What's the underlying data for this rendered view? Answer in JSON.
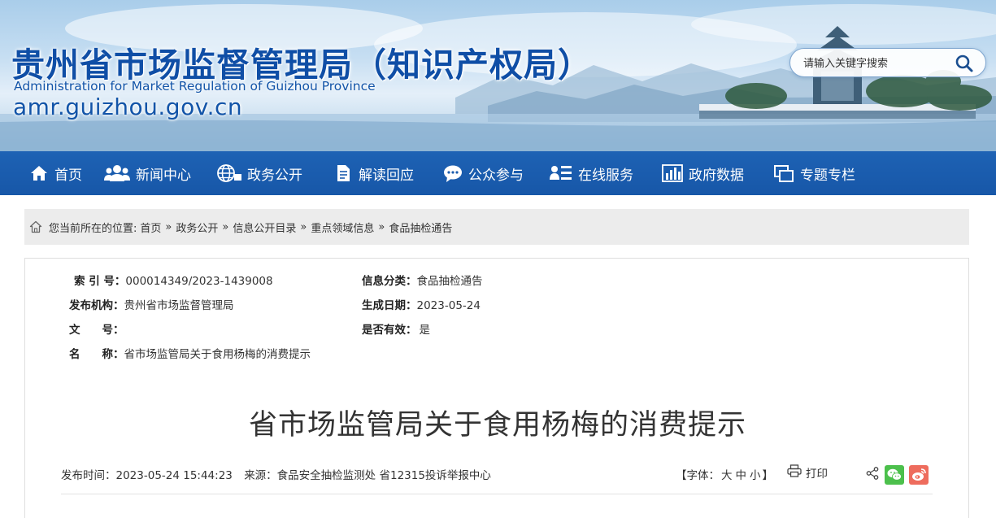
{
  "header": {
    "title_cn": "贵州省市场监督管理局（知识产权局）",
    "title_en": "Administration for Market Regulation of Guizhou Province",
    "url": "amr.guizhou.gov.cn",
    "search_placeholder": "请输入关键字搜索"
  },
  "nav": {
    "items": [
      {
        "label": "首页",
        "icon": "home-icon"
      },
      {
        "label": "新闻中心",
        "icon": "people-icon"
      },
      {
        "label": "政务公开",
        "icon": "globe-icon"
      },
      {
        "label": "解读回应",
        "icon": "document-icon"
      },
      {
        "label": "公众参与",
        "icon": "chat-icon"
      },
      {
        "label": "在线服务",
        "icon": "list-user-icon"
      },
      {
        "label": "政府数据",
        "icon": "bar-chart-icon"
      },
      {
        "label": "专题专栏",
        "icon": "windows-icon"
      }
    ]
  },
  "breadcrumb": {
    "prefix": "您当前所在的位置:",
    "items": [
      "首页",
      "政务公开",
      "信息公开目录",
      "重点领域信息",
      "食品抽检通告"
    ],
    "separator": "»"
  },
  "meta": {
    "index_label": "索 引 号：",
    "index_value": "000014349/2023-1439008",
    "category_label": "信息分类：",
    "category_value": "食品抽检通告",
    "publisher_label": "发布机构：",
    "publisher_value": "贵州省市场监督管理局",
    "date_label": "生成日期：",
    "date_value": "2023-05-24",
    "docno_label": "文　　号：",
    "docno_value": "",
    "valid_label": "是否有效：",
    "valid_value": "是",
    "name_label": "名　　称：",
    "name_value": "省市场监管局关于食用杨梅的消费提示"
  },
  "article": {
    "title": "省市场监管局关于食用杨梅的消费提示",
    "publish_time": "发布时间：2023-05-24 15:44:23",
    "source": "来源：食品安全抽检监测处 省12315投诉举报中心",
    "font_label_open": "【字体：",
    "font_large": "大",
    "font_medium": "中",
    "font_small": "小",
    "font_label_close": "】",
    "print_label": "打印"
  },
  "colors": {
    "nav_bg": "#1b5cae",
    "title_blue": "#0f4ea6",
    "wechat_green": "#4cc04c",
    "weibo_red": "#ee6c5d"
  }
}
